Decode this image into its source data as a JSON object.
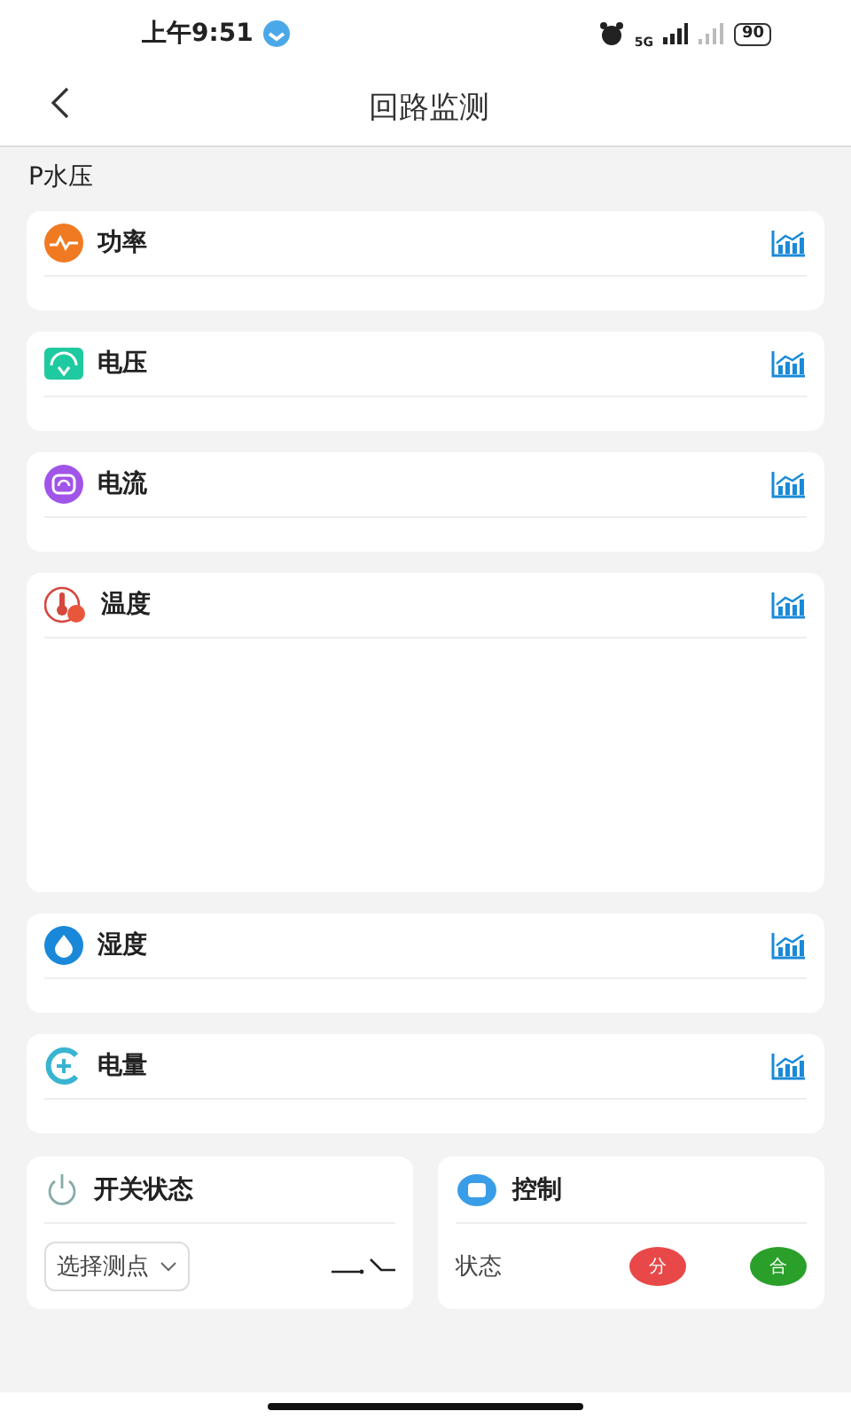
{
  "status_bar": {
    "time": "上午9:51",
    "network": "5G",
    "battery": "90"
  },
  "header": {
    "title": "回路监测"
  },
  "section_label": "P水压",
  "metrics": [
    {
      "kind": "power",
      "label": "功率",
      "tall": false
    },
    {
      "kind": "voltage",
      "label": "电压",
      "tall": false
    },
    {
      "kind": "current",
      "label": "电流",
      "tall": false
    },
    {
      "kind": "temperature",
      "label": "温度",
      "tall": true
    },
    {
      "kind": "humidity",
      "label": "湿度",
      "tall": false
    },
    {
      "kind": "energy",
      "label": "电量",
      "tall": false
    }
  ],
  "switch_panel": {
    "title": "开关状态",
    "select_placeholder": "选择测点"
  },
  "control_panel": {
    "title": "控制",
    "status_label": "状态",
    "buttons": [
      {
        "kind": "open",
        "label": "分"
      },
      {
        "kind": "close",
        "label": "合"
      }
    ]
  }
}
